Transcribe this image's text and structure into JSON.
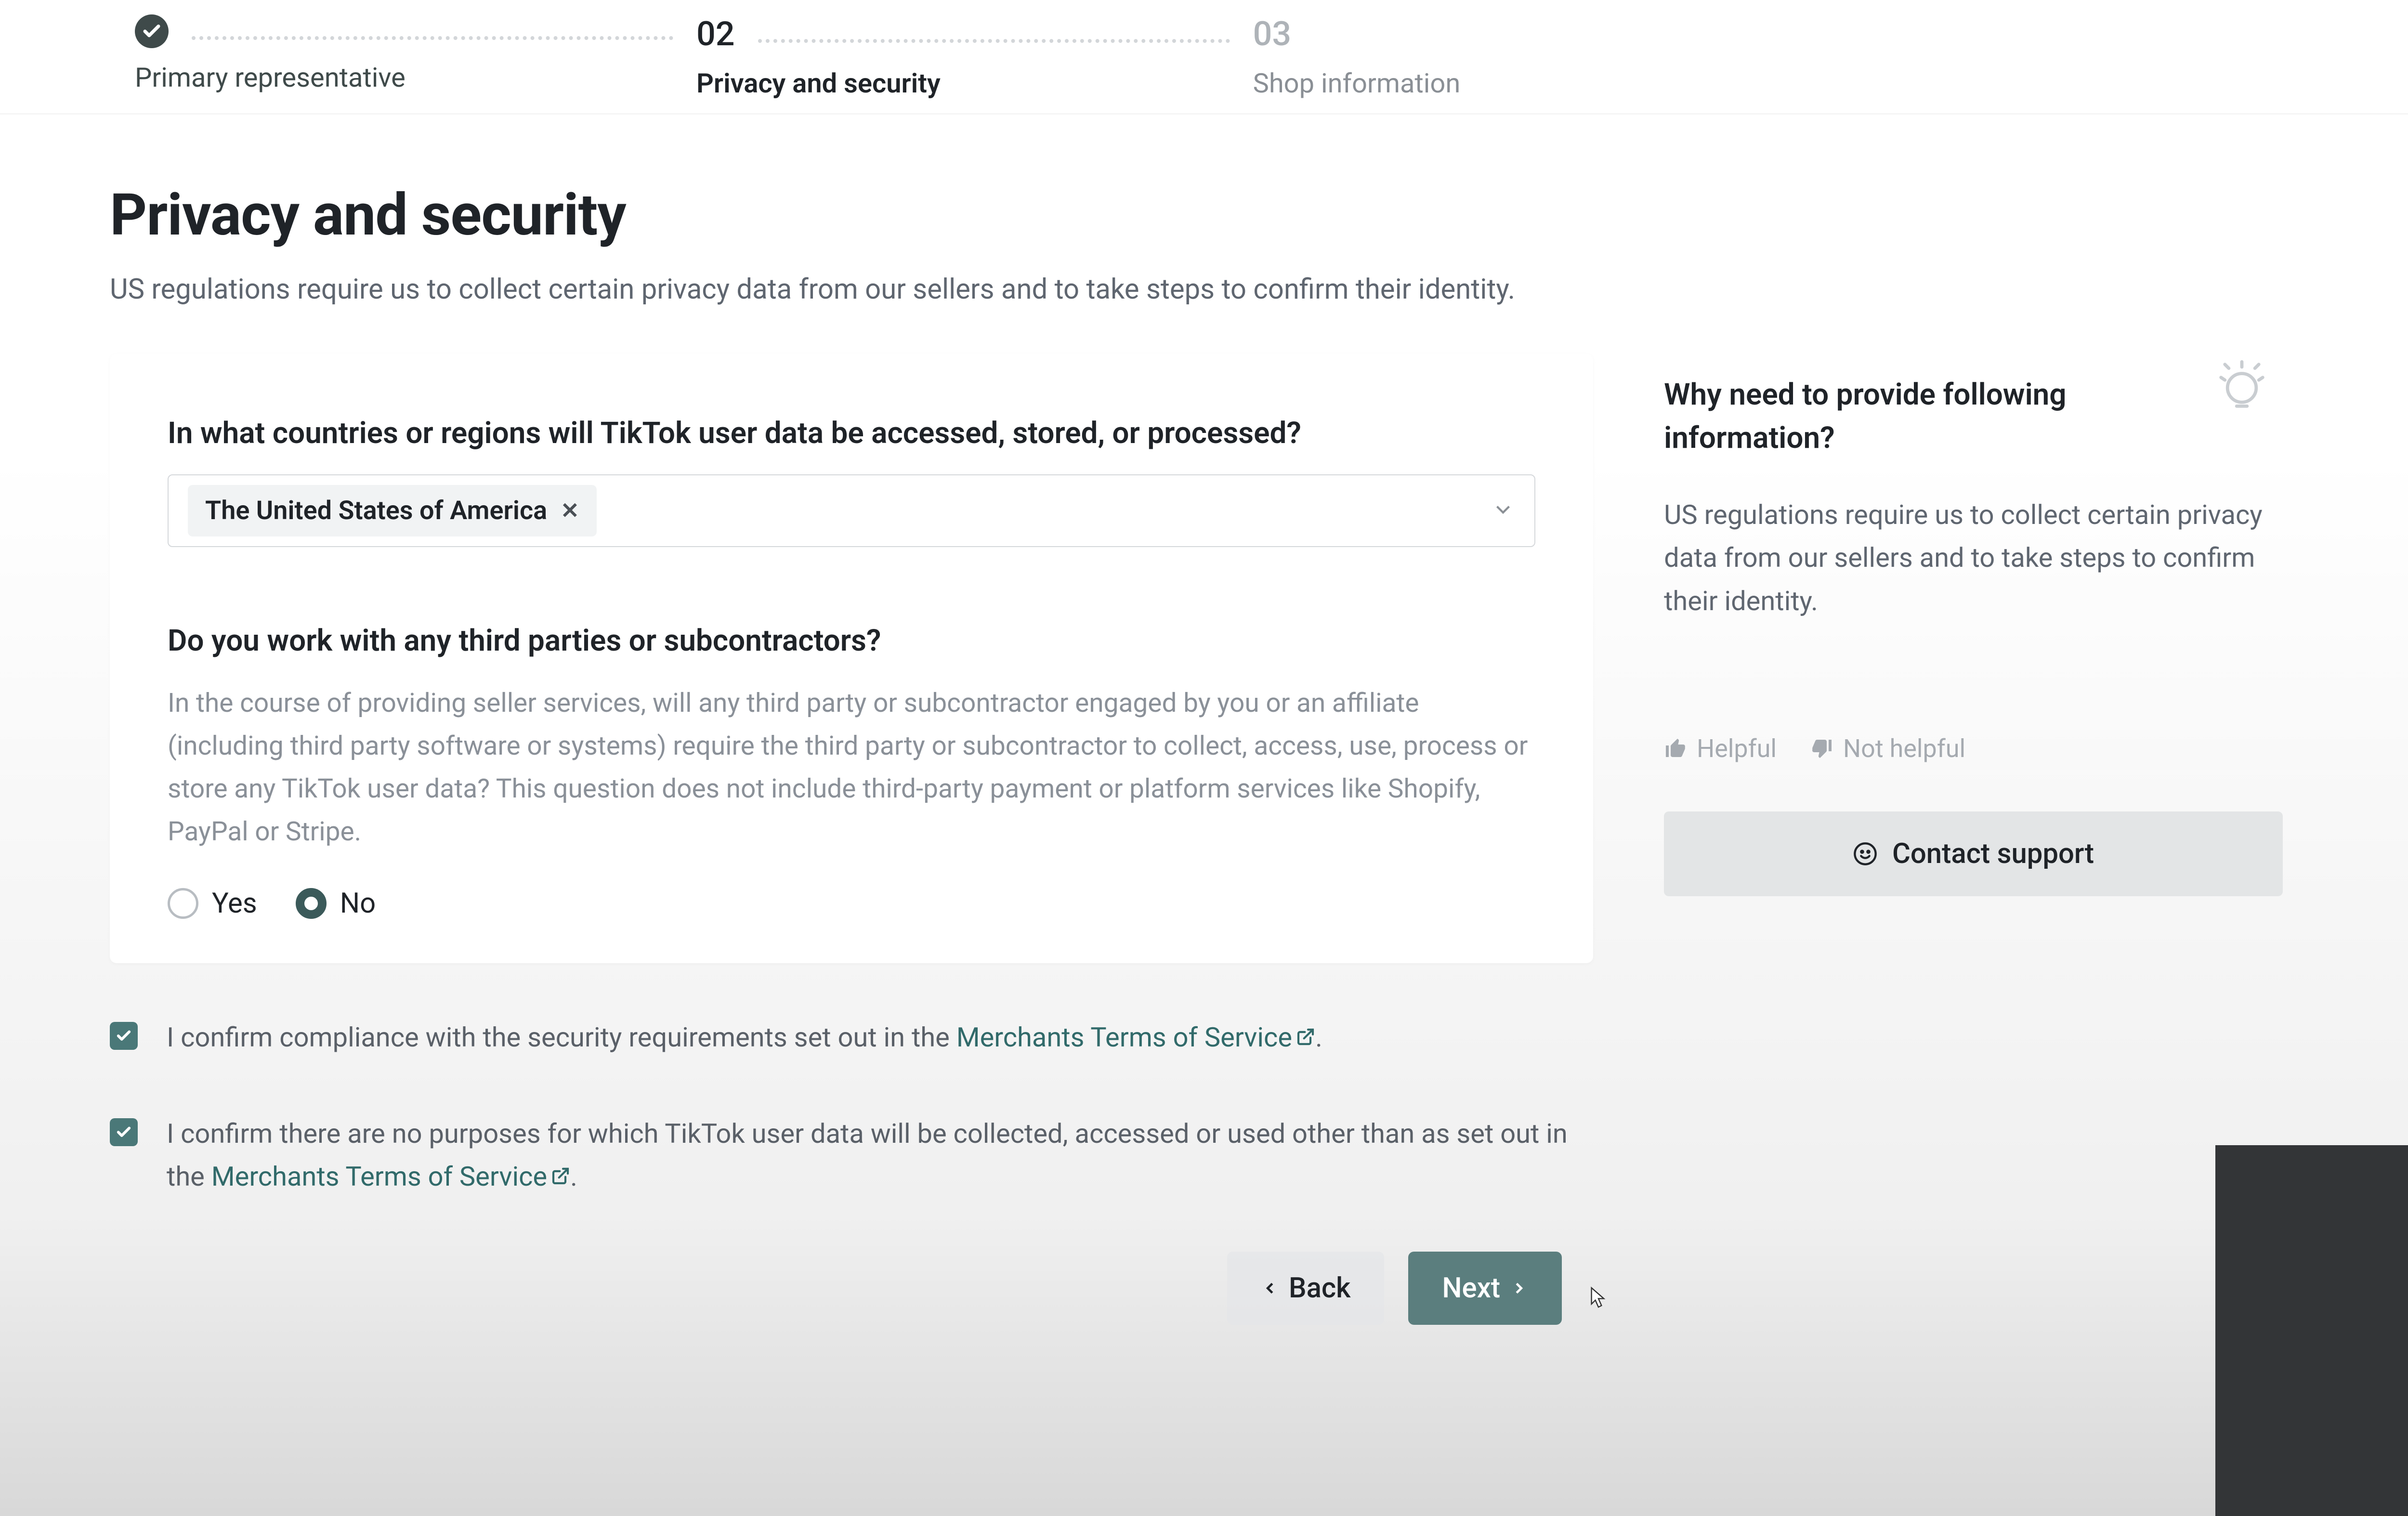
{
  "stepper": {
    "steps": [
      {
        "label": "Primary representative",
        "status": "done"
      },
      {
        "number": "02",
        "label": "Privacy and security",
        "status": "active"
      },
      {
        "number": "03",
        "label": "Shop information",
        "status": "pending"
      }
    ]
  },
  "header": {
    "title": "Privacy and security",
    "subtitle": "US regulations require us to collect certain privacy data from our sellers and to take steps to confirm their identity."
  },
  "questions": {
    "countries": {
      "title": "In what countries or regions will TikTok user data be accessed, stored, or processed?",
      "selected": "The United States of America"
    },
    "thirdparty": {
      "title": "Do you work with any third parties or subcontractors?",
      "description": "In the course of providing seller services, will any third party or subcontractor engaged by you or an affiliate (including third party software or systems) require the third party or subcontractor to collect, access, use, process or store any TikTok user data? This question does not include third-party payment or platform services like Shopify, PayPal or Stripe.",
      "options": {
        "yes": "Yes",
        "no": "No"
      },
      "selected": "no"
    }
  },
  "sidebar": {
    "title": "Why need to provide following information?",
    "text": "US regulations require us to collect certain privacy data from our sellers and to take steps to confirm their identity.",
    "helpful": "Helpful",
    "not_helpful": "Not helpful",
    "contact": "Contact support"
  },
  "confirmations": {
    "c1_prefix": "I confirm compliance with the security requirements set out in the ",
    "c1_link": "Merchants Terms of Service",
    "c1_suffix": ".",
    "c2_prefix": "I confirm there are no purposes for which TikTok user data will be collected, accessed or used other than as set out in the ",
    "c2_link": "Merchants Terms of Service",
    "c2_suffix": "."
  },
  "buttons": {
    "back": "Back",
    "next": "Next"
  }
}
